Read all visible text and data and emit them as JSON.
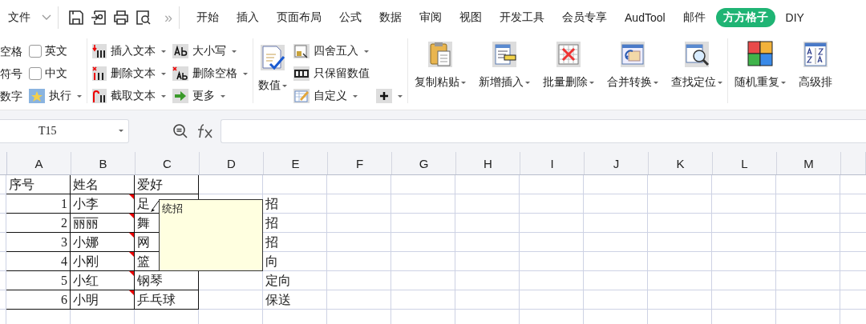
{
  "menu_bar": {
    "file_menu": "文件",
    "overflow": "»",
    "tabs": [
      {
        "label": "开始",
        "selected": false
      },
      {
        "label": "插入",
        "selected": false
      },
      {
        "label": "页面布局",
        "selected": false
      },
      {
        "label": "公式",
        "selected": false
      },
      {
        "label": "数据",
        "selected": false
      },
      {
        "label": "审阅",
        "selected": false
      },
      {
        "label": "视图",
        "selected": false
      },
      {
        "label": "开发工具",
        "selected": false
      },
      {
        "label": "会员专享",
        "selected": false
      },
      {
        "label": "AudTool",
        "selected": false
      },
      {
        "label": "邮件",
        "selected": false
      },
      {
        "label": "方方格子",
        "selected": true
      },
      {
        "label": "DIY",
        "selected": false
      }
    ]
  },
  "ribbon": {
    "options": [
      {
        "label": "空格"
      },
      {
        "label": "符号"
      },
      {
        "label": "数字"
      }
    ],
    "checkboxes": [
      {
        "label": "英文",
        "checked": false
      },
      {
        "label": "中文",
        "checked": false
      }
    ],
    "run_button": {
      "label": "执行",
      "dropdown": true
    },
    "text_tools": [
      {
        "label": "插入文本",
        "dropdown": true
      },
      {
        "label": "删除文本",
        "dropdown": true
      },
      {
        "label": "截取文本",
        "dropdown": true
      }
    ],
    "case_tools": [
      {
        "label": "大小写",
        "dropdown": true
      },
      {
        "label": "删除空格",
        "dropdown": true
      },
      {
        "label": "更多",
        "dropdown": true
      }
    ],
    "number_button": {
      "label": "数值",
      "dropdown": true
    },
    "number_tools": [
      {
        "label": "四舍五入",
        "dropdown": true
      },
      {
        "label": "只保留数值",
        "dropdown": false
      },
      {
        "label": "自定义",
        "dropdown": true
      }
    ],
    "add_button": {
      "dropdown": true
    },
    "large_tools": [
      {
        "label": "复制粘贴",
        "dropdown": true
      },
      {
        "label": "新增插入",
        "dropdown": true
      },
      {
        "label": "批量删除",
        "dropdown": true
      },
      {
        "label": "合并转换",
        "dropdown": true
      },
      {
        "label": "查找定位",
        "dropdown": true
      }
    ],
    "extra_tools": [
      {
        "label": "随机重复",
        "dropdown": true
      },
      {
        "label": "高级排",
        "dropdown": false
      }
    ]
  },
  "formula_bar": {
    "name_box": "T15"
  },
  "sheet": {
    "columns": [
      "A",
      "B",
      "C",
      "D",
      "E",
      "F",
      "G",
      "H",
      "I",
      "J",
      "K",
      "L",
      "M"
    ],
    "rows": [
      {
        "comment": false,
        "A": "序号",
        "B": "姓名",
        "C": "爱好"
      },
      {
        "comment": true,
        "A": "1",
        "B": "小李",
        "C": "足",
        "E": "招"
      },
      {
        "comment": true,
        "A": "2",
        "B": "丽丽",
        "C": "舞",
        "E": "招"
      },
      {
        "comment": true,
        "A": "3",
        "B": "小娜",
        "C": "网",
        "E": "招"
      },
      {
        "comment": true,
        "A": "4",
        "B": "小刚",
        "C": "篮",
        "E": "向"
      },
      {
        "comment": true,
        "A": "5",
        "B": "小红",
        "C": "钢琴",
        "E": "定向"
      },
      {
        "comment": true,
        "A": "6",
        "B": "小明",
        "C": "乒乓球",
        "E": "保送"
      }
    ],
    "comment": {
      "text": "统招"
    }
  }
}
